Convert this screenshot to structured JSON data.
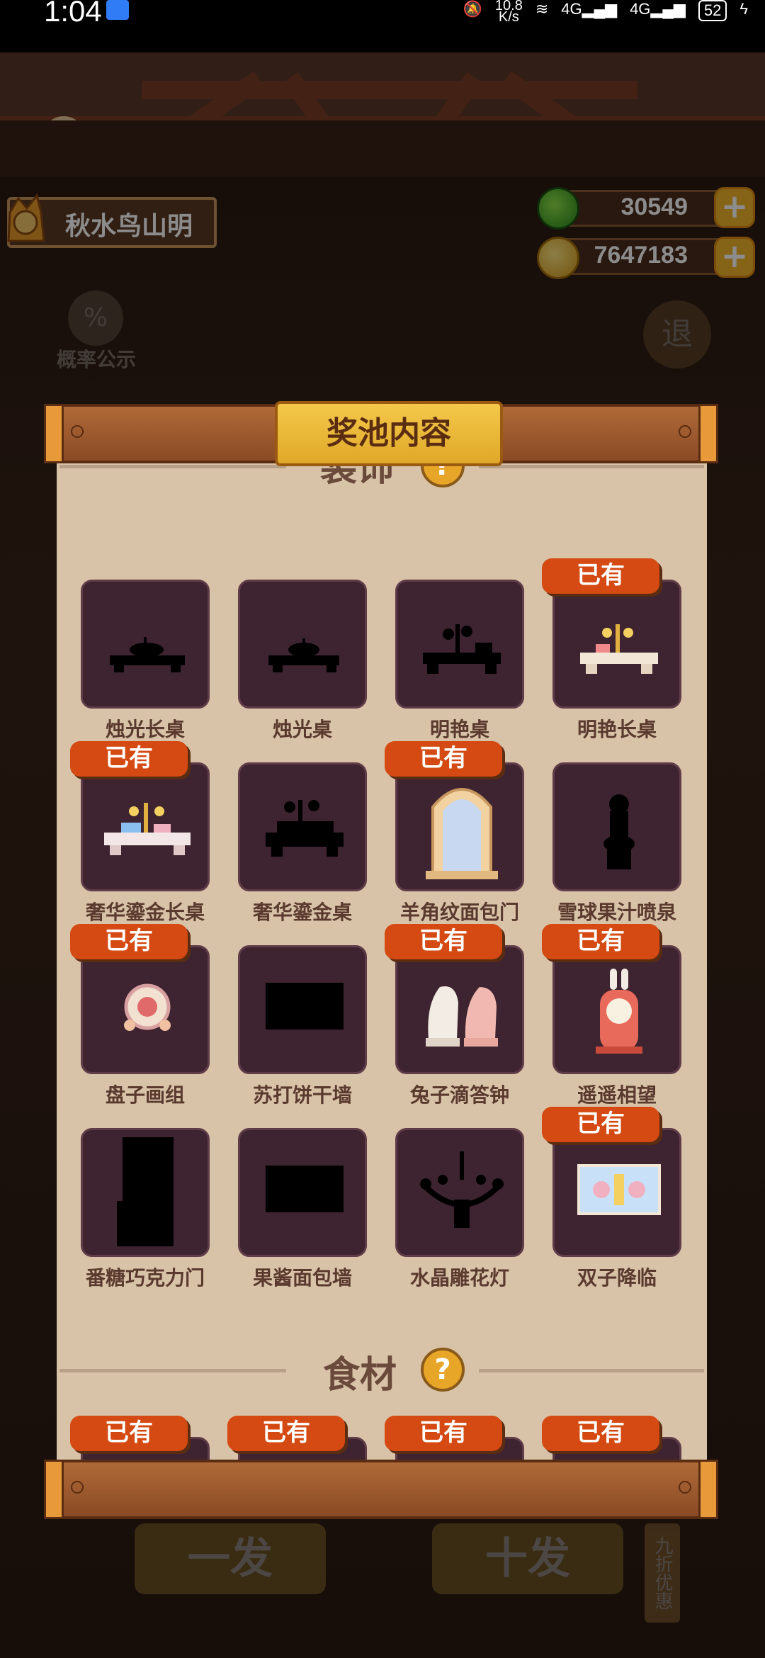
{
  "status_bar": {
    "time": "1:04",
    "net_speed_top": "10.8",
    "net_speed_bottom": "K/s",
    "signal1": "4G",
    "signal2": "4G",
    "battery": "52"
  },
  "player": {
    "name": "秋水鸟山明"
  },
  "currencies": {
    "gems": "30549",
    "coins": "7647183"
  },
  "background_buttons": {
    "probability": "概率公示",
    "exit": "退",
    "single_draw": "一发",
    "ten_draw": "十发",
    "discount": "九折优惠"
  },
  "modal": {
    "title": "奖池内容",
    "section1_title": "装饰",
    "section2_title": "食材",
    "help_symbol": "?",
    "owned_label": "已有",
    "items": [
      {
        "name": "烛光长桌",
        "owned": false
      },
      {
        "name": "烛光桌",
        "owned": false
      },
      {
        "name": "明艳桌",
        "owned": false
      },
      {
        "name": "明艳长桌",
        "owned": true
      },
      {
        "name": "奢华鎏金长桌",
        "owned": true
      },
      {
        "name": "奢华鎏金桌",
        "owned": false
      },
      {
        "name": "羊角纹面包门",
        "owned": true
      },
      {
        "name": "雪球果汁喷泉",
        "owned": false
      },
      {
        "name": "盘子画组",
        "owned": true
      },
      {
        "name": "苏打饼干墙",
        "owned": false
      },
      {
        "name": "兔子滴答钟",
        "owned": true
      },
      {
        "name": "遥遥相望",
        "owned": true
      },
      {
        "name": "番糖巧克力门",
        "owned": false
      },
      {
        "name": "果酱面包墙",
        "owned": false
      },
      {
        "name": "水晶雕花灯",
        "owned": false
      },
      {
        "name": "双子降临",
        "owned": true
      }
    ]
  },
  "colors": {
    "owned_badge": "#d44a12",
    "item_box": "#3e2430",
    "paper": "#d8c3a8",
    "title_plate": "#f4c84a"
  }
}
